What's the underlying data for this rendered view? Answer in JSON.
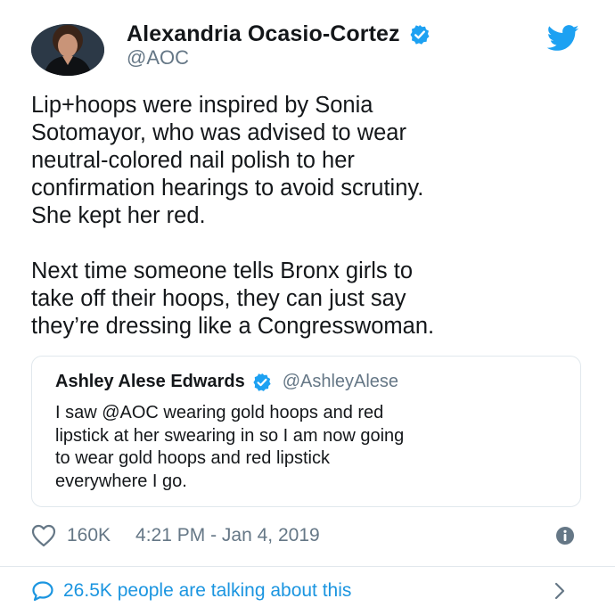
{
  "author": {
    "display_name": "Alexandria Ocasio-Cortez",
    "handle": "@AOC",
    "verified": true
  },
  "tweet": {
    "paragraphs": [
      [
        "Lip+hoops were inspired by Sonia",
        "Sotomayor, who was advised to wear",
        "neutral-colored nail polish to her",
        "confirmation hearings to avoid scrutiny.",
        "She kept her red."
      ],
      [
        "Next time someone tells Bronx girls to",
        "take off their hoops, they can just say",
        "they’re dressing like a Congresswoman."
      ]
    ]
  },
  "quoted_tweet": {
    "display_name": "Ashley Alese Edwards",
    "handle": "@AshleyAlese",
    "verified": true,
    "lines": [
      "I saw @AOC wearing gold hoops and red",
      "lipstick at her swearing in so I am now going",
      "to wear gold hoops and red lipstick",
      "everywhere I go."
    ]
  },
  "meta": {
    "like_count": "160K",
    "timestamp": "4:21 PM - Jan 4, 2019"
  },
  "footer": {
    "talking_text": "26.5K people are talking about this"
  },
  "icons": {
    "verified": "verified-badge-icon",
    "twitter": "twitter-bird-icon",
    "like": "heart-icon",
    "info": "info-icon",
    "reply": "speech-bubble-icon",
    "chevron": "chevron-right-icon"
  },
  "colors": {
    "twitter_blue": "#1da1f2",
    "link_blue": "#1b95e0",
    "secondary_text": "#657786",
    "primary_text": "#14171a",
    "border": "#e1e8ed"
  }
}
